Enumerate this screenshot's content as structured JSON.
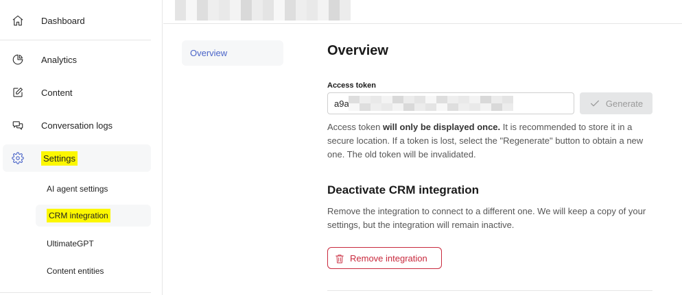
{
  "sidebar": {
    "items": [
      {
        "label": "Dashboard",
        "icon": "home-icon"
      },
      {
        "label": "Analytics",
        "icon": "pie-chart-icon"
      },
      {
        "label": "Content",
        "icon": "edit-icon"
      },
      {
        "label": "Conversation logs",
        "icon": "chat-bubbles-icon"
      },
      {
        "label": "Settings",
        "icon": "gear-icon"
      }
    ],
    "sub_items": [
      {
        "label": "AI agent settings"
      },
      {
        "label": "CRM integration"
      },
      {
        "label": "UltimateGPT"
      },
      {
        "label": "Content entities"
      }
    ],
    "highlight_color": "#fcf700",
    "accent_color": "#4a64c8"
  },
  "inner_nav": {
    "overview_label": "Overview"
  },
  "main": {
    "title": "Overview",
    "access_token": {
      "label": "Access token",
      "value_prefix": "a9a"
    },
    "generate_label": "Generate",
    "help": {
      "before": "Access token ",
      "bold": "will only be displayed once.",
      "after": " It is recommended to store it in a secure location. If a token is lost, select the \"Regenerate\" button to obtain a new one. The old token will be invalidated."
    },
    "deactivate": {
      "title": "Deactivate CRM integration",
      "description": "Remove the integration to connect to a different one. We will keep a copy of your settings, but the integration will remain inactive.",
      "remove_label": "Remove integration"
    },
    "danger_color": "#c8283c"
  }
}
